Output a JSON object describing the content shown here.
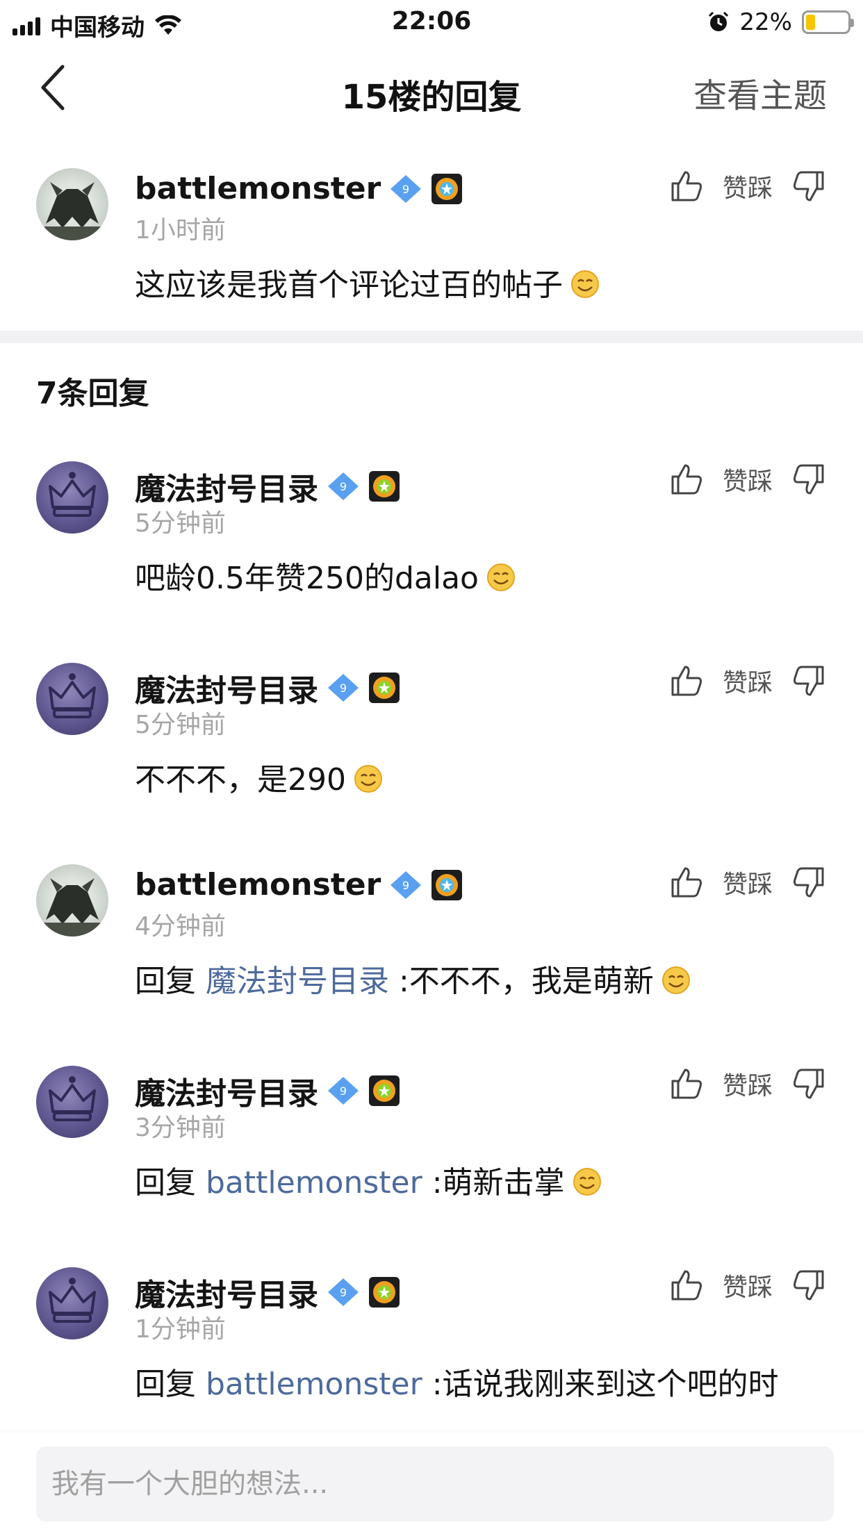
{
  "status_bar": {
    "carrier": "中国移动",
    "time": "22:06",
    "battery_percent": "22%",
    "battery_level": 0.22,
    "icons": [
      "signal-icon",
      "wifi-icon",
      "alarm-icon",
      "battery-icon"
    ]
  },
  "nav": {
    "title": "15楼的回复",
    "right_link": "查看主题",
    "back_icon": "chevron-left-icon"
  },
  "action_labels": {
    "vote": "赞踩"
  },
  "main_post": {
    "username": "battlemonster",
    "level": "9",
    "time": "1小时前",
    "content": "这应该是我首个评论过百的帖子",
    "avatar": "monster-avatar"
  },
  "reply_count_label": "7条回复",
  "replies": [
    {
      "username": "魔法封号目录",
      "level": "9",
      "time": "5分钟前",
      "prefix": "",
      "mention": "",
      "text": "吧龄0.5年赞250的dalao"
    },
    {
      "username": "魔法封号目录",
      "level": "9",
      "time": "5分钟前",
      "prefix": "",
      "mention": "",
      "text": "不不不，是290"
    },
    {
      "username": "battlemonster",
      "level": "9",
      "time": "4分钟前",
      "prefix": "回复 ",
      "mention": "魔法封号目录",
      "text": " :不不不，我是萌新"
    },
    {
      "username": "魔法封号目录",
      "level": "9",
      "time": "3分钟前",
      "prefix": "回复 ",
      "mention": "battlemonster",
      "text": " :萌新击掌"
    },
    {
      "username": "魔法封号目录",
      "level": "9",
      "time": "1分钟前",
      "prefix": "回复 ",
      "mention": "battlemonster",
      "text": " :话说我刚来到这个吧的时"
    }
  ],
  "input": {
    "placeholder": "我有一个大胆的想法..."
  },
  "colors": {
    "mention": "#4d6a9c",
    "battery": "#f7c400",
    "badge": "#5aa0f0"
  }
}
